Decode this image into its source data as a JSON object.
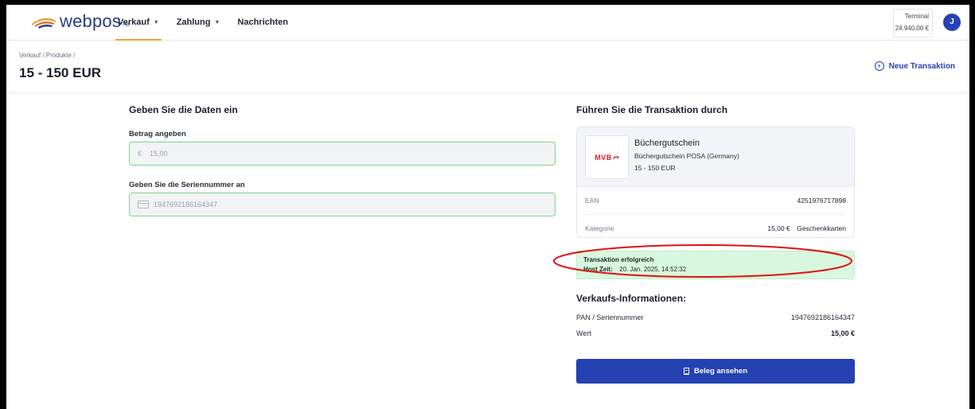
{
  "brand": {
    "name": "webpos",
    "suffix": "TM",
    "accent": "#f0a032",
    "primary": "#2541b2"
  },
  "nav": [
    {
      "label": "Verkauf",
      "has_dropdown": true,
      "active": true
    },
    {
      "label": "Zahlung",
      "has_dropdown": true,
      "active": false
    },
    {
      "label": "Nachrichten",
      "has_dropdown": false,
      "active": false
    }
  ],
  "terminal": {
    "label": "Terminal",
    "value": "24.940,00 €"
  },
  "user": {
    "initial": "J"
  },
  "breadcrumb": "Verkauf / Produkte /",
  "page_title": "15 - 150 EUR",
  "new_transaction_label": "Neue Transaktion",
  "form": {
    "heading": "Geben Sie die Daten ein",
    "amount_label": "Betrag angeben",
    "amount_prefix": "€",
    "amount_value": "15,00",
    "serial_label": "Geben Sie die Seriennummer an",
    "serial_value": "1947692186164347"
  },
  "transaction": {
    "heading": "Führen Sie die Transaktion durch",
    "product": {
      "logo_text": "MVB",
      "name": "Büchergutschein",
      "subtitle": "Büchergutschein POSA (Germany)",
      "range": "15 - 150 EUR",
      "ean_label": "EAN",
      "ean_value": "4251976717898",
      "category_label": "Kategorie",
      "category_price": "15,00 €",
      "category_value": "Geschenkkarten"
    },
    "success": {
      "title": "Transaktion erfolgreich",
      "time_label": "Host Zeit:",
      "time_value": "20. Jan. 2025, 14:52:32"
    }
  },
  "sales_info": {
    "heading": "Verkaufs-Informationen:",
    "pan_label": "PAN / Seriennummer",
    "pan_value": "1947692186164347",
    "value_label": "Wert",
    "value_value": "15,00 €"
  },
  "receipt_button_label": "Beleg ansehen",
  "annotation_color": "#e01010"
}
